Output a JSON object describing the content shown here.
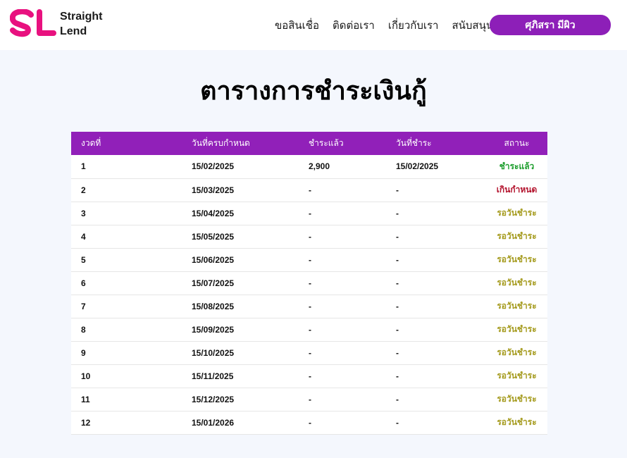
{
  "brand": {
    "line1": "Straight",
    "line2": "Lend",
    "logo_color": "#e8117f"
  },
  "nav": {
    "links": [
      "ขอสินเชื่อ",
      "ติดต่อเรา",
      "เกี่ยวกับเรา",
      "สนับสนุน"
    ],
    "user_name": "ศุภิสรา มีผิว"
  },
  "page": {
    "title": "ตารางการชำระเงินกู้"
  },
  "colors": {
    "accent": "#8d1fb8",
    "paid": "#1e9e2e",
    "overdue": "#b3122c",
    "waiting": "#a59b1e"
  },
  "table": {
    "headers": [
      "งวดที่",
      "วันที่ครบกำหนด",
      "ชำระแล้ว",
      "วันที่ชำระ",
      "สถานะ"
    ],
    "rows": [
      {
        "no": "1",
        "due": "15/02/2025",
        "paid": "2,900",
        "paid_date": "15/02/2025",
        "status": "ชำระแล้ว",
        "kind": "paid"
      },
      {
        "no": "2",
        "due": "15/03/2025",
        "paid": "-",
        "paid_date": "-",
        "status": "เกินกำหนด",
        "kind": "overdue"
      },
      {
        "no": "3",
        "due": "15/04/2025",
        "paid": "-",
        "paid_date": "-",
        "status": "รอวันชำระ",
        "kind": "waiting"
      },
      {
        "no": "4",
        "due": "15/05/2025",
        "paid": "-",
        "paid_date": "-",
        "status": "รอวันชำระ",
        "kind": "waiting"
      },
      {
        "no": "5",
        "due": "15/06/2025",
        "paid": "-",
        "paid_date": "-",
        "status": "รอวันชำระ",
        "kind": "waiting"
      },
      {
        "no": "6",
        "due": "15/07/2025",
        "paid": "-",
        "paid_date": "-",
        "status": "รอวันชำระ",
        "kind": "waiting"
      },
      {
        "no": "7",
        "due": "15/08/2025",
        "paid": "-",
        "paid_date": "-",
        "status": "รอวันชำระ",
        "kind": "waiting"
      },
      {
        "no": "8",
        "due": "15/09/2025",
        "paid": "-",
        "paid_date": "-",
        "status": "รอวันชำระ",
        "kind": "waiting"
      },
      {
        "no": "9",
        "due": "15/10/2025",
        "paid": "-",
        "paid_date": "-",
        "status": "รอวันชำระ",
        "kind": "waiting"
      },
      {
        "no": "10",
        "due": "15/11/2025",
        "paid": "-",
        "paid_date": "-",
        "status": "รอวันชำระ",
        "kind": "waiting"
      },
      {
        "no": "11",
        "due": "15/12/2025",
        "paid": "-",
        "paid_date": "-",
        "status": "รอวันชำระ",
        "kind": "waiting"
      },
      {
        "no": "12",
        "due": "15/01/2026",
        "paid": "-",
        "paid_date": "-",
        "status": "รอวันชำระ",
        "kind": "waiting"
      }
    ]
  }
}
